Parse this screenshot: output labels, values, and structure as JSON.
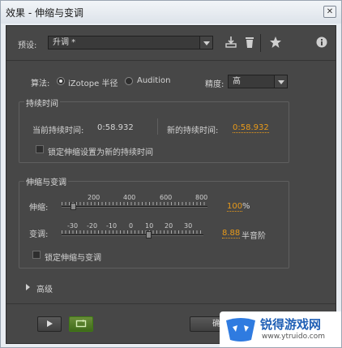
{
  "window": {
    "title": "效果 - 伸缩与变调",
    "close_glyph": "✕"
  },
  "preset": {
    "label": "预设:",
    "value": "升调 *"
  },
  "algorithm": {
    "label": "算法:",
    "options": [
      "iZotope 半径",
      "Audition"
    ],
    "selected": "iZotope 半径"
  },
  "precision": {
    "label": "精度:",
    "value": "高"
  },
  "duration": {
    "group_title": "持续时间",
    "current_label": "当前持续时间:",
    "current_value": "0:58.932",
    "new_label": "新的持续时间:",
    "new_value": "0:58.932",
    "lock_label": "锁定伸缩设置为新的持续时间"
  },
  "stretch_pitch": {
    "group_title": "伸缩与变调",
    "stretch": {
      "label": "伸缩:",
      "scale": [
        "200",
        "400",
        "600",
        "800"
      ],
      "value": "100",
      "unit": "%",
      "slider_fraction": 0.08
    },
    "pitch": {
      "label": "变调:",
      "scale": [
        "-30",
        "-20",
        "-10",
        "0",
        "10",
        "20",
        "30"
      ],
      "value": "8.88",
      "unit": "半音阶",
      "slider_fraction": 0.61
    },
    "lock_label": "锁定伸缩与变调"
  },
  "advanced": {
    "label": "高级"
  },
  "footer": {
    "ok_label": "确定"
  },
  "watermark": {
    "brand": "锐得游戏网",
    "url": "www.ytruido.com"
  },
  "colors": {
    "accent": "#e89a1a",
    "panel": "#474747"
  }
}
